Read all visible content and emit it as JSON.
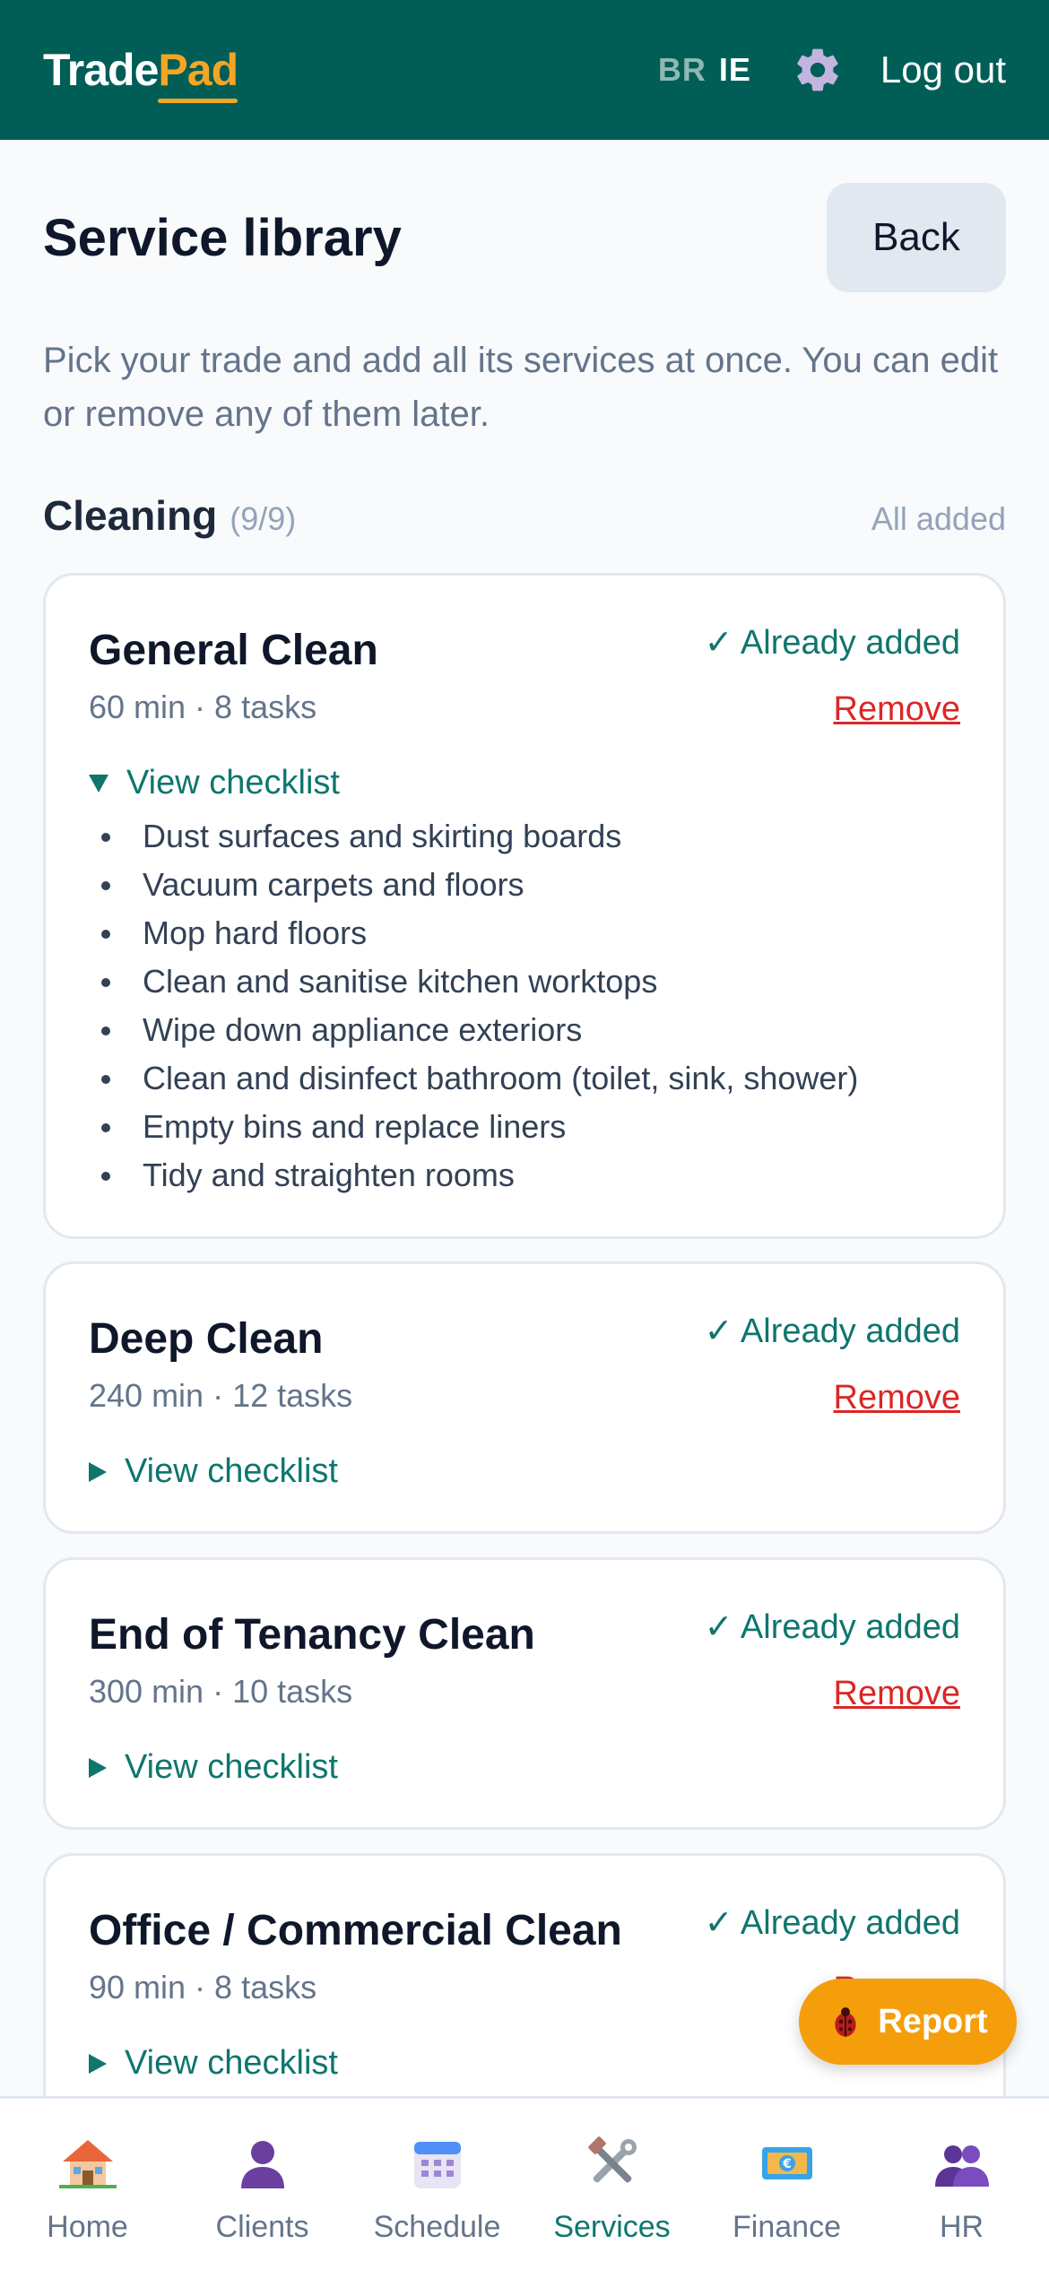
{
  "app": {
    "logo_part1": "Trade",
    "logo_part2": "Pad",
    "lang_br": "BR",
    "lang_ie": "IE",
    "logout": "Log out"
  },
  "header": {
    "title": "Service library",
    "back": "Back",
    "intro": "Pick your trade and add all its services at once. You can edit or remove any of them later."
  },
  "section": {
    "title": "Cleaning",
    "count": "(9/9)",
    "status": "All added"
  },
  "cards": [
    {
      "title": "General Clean",
      "meta": "60 min · 8 tasks",
      "status": "✓ Already added",
      "remove": "Remove",
      "toggle": "View checklist",
      "expanded": true,
      "checklist": [
        "Dust surfaces and skirting boards",
        "Vacuum carpets and floors",
        "Mop hard floors",
        "Clean and sanitise kitchen worktops",
        "Wipe down appliance exteriors",
        "Clean and disinfect bathroom (toilet, sink, shower)",
        "Empty bins and replace liners",
        "Tidy and straighten rooms"
      ]
    },
    {
      "title": "Deep Clean",
      "meta": "240 min · 12 tasks",
      "status": "✓ Already added",
      "remove": "Remove",
      "toggle": "View checklist",
      "expanded": false
    },
    {
      "title": "End of Tenancy Clean",
      "meta": "300 min · 10 tasks",
      "status": "✓ Already added",
      "remove": "Remove",
      "toggle": "View checklist",
      "expanded": false
    },
    {
      "title": "Office / Commercial Clean",
      "meta": "90 min · 8 tasks",
      "status": "✓ Already added",
      "remove": "Remove",
      "toggle": "View checklist",
      "expanded": false
    }
  ],
  "report": {
    "label": "Report"
  },
  "nav": [
    {
      "label": "Home",
      "icon": "house-icon"
    },
    {
      "label": "Clients",
      "icon": "person-icon"
    },
    {
      "label": "Schedule",
      "icon": "calendar-icon"
    },
    {
      "label": "Services",
      "icon": "tools-icon",
      "active": true
    },
    {
      "label": "Finance",
      "icon": "banknote-icon"
    },
    {
      "label": "HR",
      "icon": "people-icon"
    }
  ],
  "colors": {
    "brand": "#005e57",
    "accent": "#f5a524",
    "success": "#0f766e",
    "danger": "#dc2626"
  }
}
